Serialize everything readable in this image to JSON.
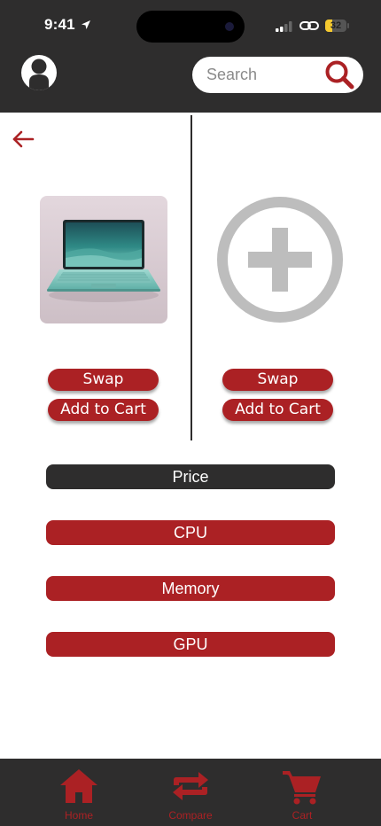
{
  "status_bar": {
    "time": "9:41",
    "battery_level": "32",
    "battery_fraction": 0.32
  },
  "header": {
    "search": {
      "placeholder": "Search",
      "value": ""
    }
  },
  "compare": {
    "left_slot": {
      "image_alt": "Laptop",
      "swap_label": "Swap",
      "add_to_cart_label": "Add to Cart"
    },
    "right_slot": {
      "swap_label": "Swap",
      "add_to_cart_label": "Add to Cart"
    }
  },
  "specs": [
    {
      "label": "Price",
      "selected": true
    },
    {
      "label": "CPU",
      "selected": false
    },
    {
      "label": "Memory",
      "selected": false
    },
    {
      "label": "GPU",
      "selected": false
    }
  ],
  "bottom_nav": [
    {
      "label": "Home",
      "icon": "home-icon"
    },
    {
      "label": "Compare",
      "icon": "compare-icon"
    },
    {
      "label": "Cart",
      "icon": "cart-icon"
    }
  ],
  "colors": {
    "accent": "#ab2124",
    "header_bg": "#2e2d2d",
    "placeholder_gray": "#bdbdbd",
    "battery": "#f5c92f"
  }
}
